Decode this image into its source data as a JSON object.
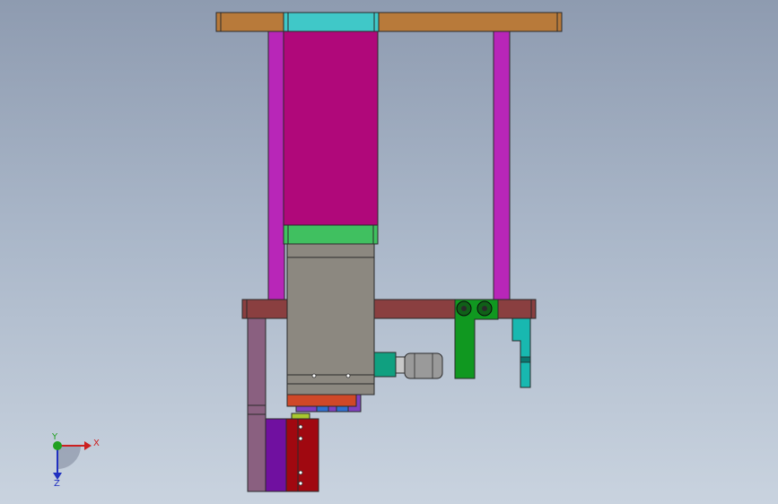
{
  "axis_triad": {
    "x_label": "X",
    "y_label": "Y",
    "z_label": "Z",
    "x_color": "#cc2020",
    "y_color": "#20a020",
    "z_color": "#2030c0"
  },
  "colors": {
    "top_plate": "#b87a3a",
    "top_plate_center": "#40c8c8",
    "cylinder_body": "#b0087a",
    "side_rod": "#b826b8",
    "cylinder_collar": "#40c060",
    "gray_block": "#8c8880",
    "mid_plate": "#8a3f40",
    "left_post": "#8a6080",
    "green_bracket": "#109820",
    "teal_bracket": "#18b8b0",
    "sensor_body": "#9a9a9a",
    "sensor_cap": "#10a080",
    "red_base": "#d04828",
    "violet_strip": "#8040c0",
    "purple_block": "#7010a0",
    "red_block": "#a00810",
    "yellow_pin": "#a8c830"
  }
}
